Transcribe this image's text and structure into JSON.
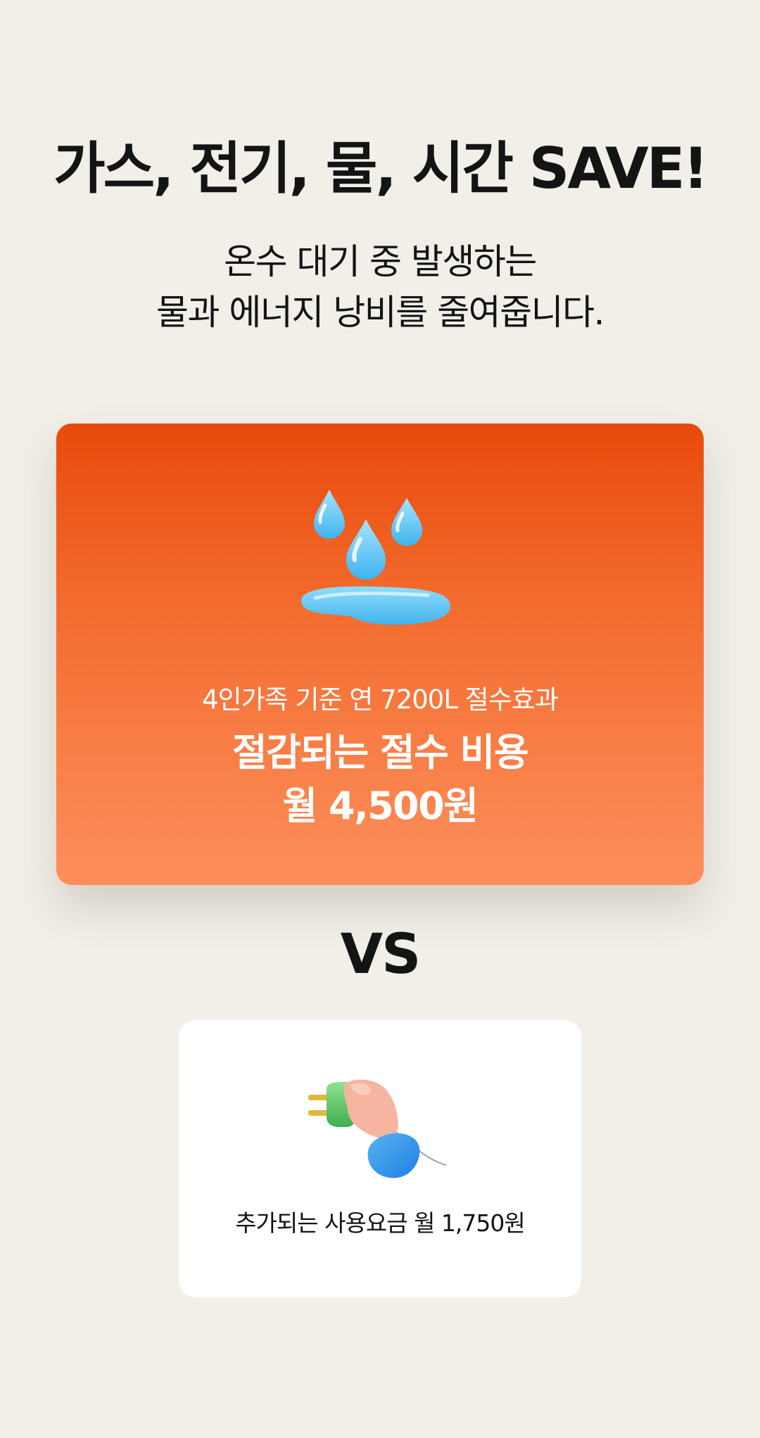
{
  "headline": "가스, 전기, 물, 시간 SAVE!",
  "subtitle": {
    "line1": "온수 대기 중 발생하는",
    "line2": "물과 에너지 낭비를 줄여줍니다."
  },
  "savings_card": {
    "icon": "water-drops-icon",
    "caption": "4인가족 기준 연 7200L 절수효과",
    "title_line1": "절감되는 절수 비용",
    "title_line2": "월 4,500원",
    "gradient_top": "#e84a0b",
    "gradient_bottom": "#fd8f5c"
  },
  "vs_label": "VS",
  "cost_card": {
    "icon": "electric-plug-icon",
    "caption": "추가되는 사용요금 월 1,750원"
  }
}
